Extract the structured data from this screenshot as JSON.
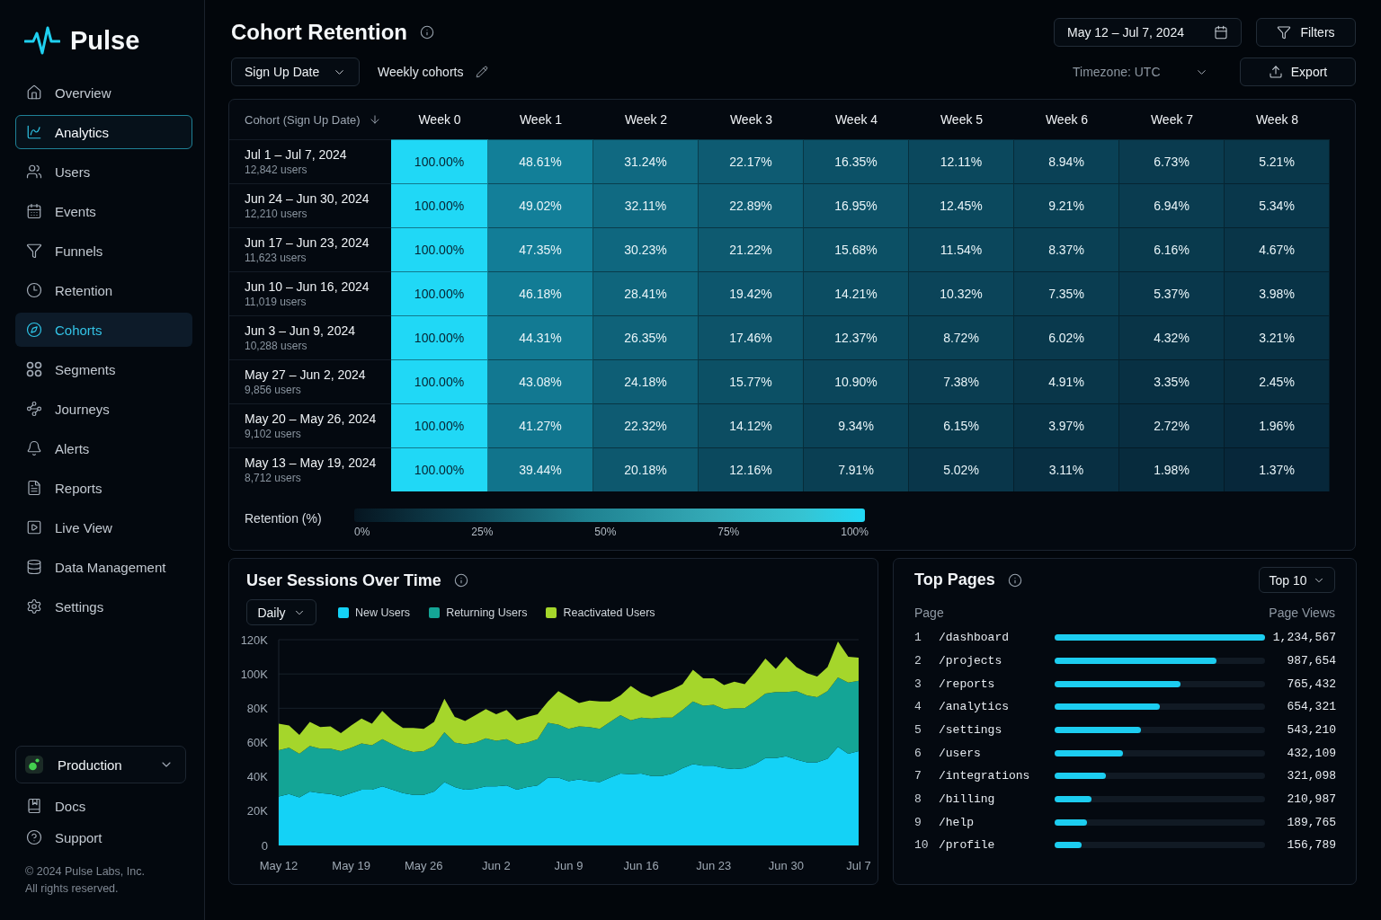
{
  "sidebar": {
    "brand": "Pulse",
    "nav": [
      {
        "label": "Overview",
        "selected": false,
        "focused": false
      },
      {
        "label": "Analytics",
        "selected": false,
        "focused": true
      },
      {
        "label": "Users",
        "selected": false,
        "focused": false
      },
      {
        "label": "Events",
        "selected": false,
        "focused": false
      },
      {
        "label": "Funnels",
        "selected": false,
        "focused": false
      },
      {
        "label": "Retention",
        "selected": false,
        "focused": false
      },
      {
        "label": "Cohorts",
        "selected": true,
        "focused": false
      },
      {
        "label": "Segments",
        "selected": false,
        "focused": false
      },
      {
        "label": "Journeys",
        "selected": false,
        "focused": false
      },
      {
        "label": "Alerts",
        "selected": false,
        "focused": false
      },
      {
        "label": "Reports",
        "selected": false,
        "focused": false
      },
      {
        "label": "Live View",
        "selected": false,
        "focused": false
      },
      {
        "label": "Data Management",
        "selected": false,
        "focused": false
      },
      {
        "label": "Settings",
        "selected": false,
        "focused": false
      }
    ],
    "environment": "Production",
    "links": [
      "Docs",
      "Support"
    ],
    "footer": [
      "© 2024 Pulse Labs, Inc.",
      "All rights reserved."
    ]
  },
  "header": {
    "title": "Cohort Retention",
    "date_range": "May 12 – Jul 7, 2024",
    "filters": "Filters",
    "cohort_by": "Sign Up Date",
    "cohort_type": "Weekly cohorts",
    "timezone": "Timezone: UTC",
    "export": "Export"
  },
  "retention_table": {
    "cohort_column": "Cohort (Sign Up Date)",
    "columns": [
      "Week 0",
      "Week 1",
      "Week 2",
      "Week 3",
      "Week 4",
      "Week 5",
      "Week 6",
      "Week 7",
      "Week 8"
    ],
    "rows": [
      {
        "cohort": "Jul 1 – Jul 7, 2024",
        "users": "12,842 users",
        "cells": [
          "100.00%",
          "48.61%",
          "31.24%",
          "22.17%",
          "16.35%",
          "12.11%",
          "8.94%",
          "6.73%",
          "5.21%"
        ]
      },
      {
        "cohort": "Jun 24 – Jun 30, 2024",
        "users": "12,210 users",
        "cells": [
          "100.00%",
          "49.02%",
          "32.11%",
          "22.89%",
          "16.95%",
          "12.45%",
          "9.21%",
          "6.94%",
          "5.34%"
        ]
      },
      {
        "cohort": "Jun 17 – Jun 23, 2024",
        "users": "11,623 users",
        "cells": [
          "100.00%",
          "47.35%",
          "30.23%",
          "21.22%",
          "15.68%",
          "11.54%",
          "8.37%",
          "6.16%",
          "4.67%"
        ]
      },
      {
        "cohort": "Jun 10 – Jun 16, 2024",
        "users": "11,019 users",
        "cells": [
          "100.00%",
          "46.18%",
          "28.41%",
          "19.42%",
          "14.21%",
          "10.32%",
          "7.35%",
          "5.37%",
          "3.98%"
        ]
      },
      {
        "cohort": "Jun 3 – Jun 9, 2024",
        "users": "10,288 users",
        "cells": [
          "100.00%",
          "44.31%",
          "26.35%",
          "17.46%",
          "12.37%",
          "8.72%",
          "6.02%",
          "4.32%",
          "3.21%"
        ]
      },
      {
        "cohort": "May 27 – Jun 2, 2024",
        "users": "9,856 users",
        "cells": [
          "100.00%",
          "43.08%",
          "24.18%",
          "15.77%",
          "10.90%",
          "7.38%",
          "4.91%",
          "3.35%",
          "2.45%"
        ]
      },
      {
        "cohort": "May 20 – May 26, 2024",
        "users": "9,102 users",
        "cells": [
          "100.00%",
          "41.27%",
          "22.32%",
          "14.12%",
          "9.34%",
          "6.15%",
          "3.97%",
          "2.72%",
          "1.96%"
        ]
      },
      {
        "cohort": "May 13 – May 19, 2024",
        "users": "8,712 users",
        "cells": [
          "100.00%",
          "39.44%",
          "20.18%",
          "12.16%",
          "7.91%",
          "5.02%",
          "3.11%",
          "1.98%",
          "1.37%"
        ]
      }
    ],
    "scale": {
      "label": "Retention (%)",
      "ticks": [
        "0%",
        "25%",
        "50%",
        "75%",
        "100%"
      ]
    }
  },
  "sessions": {
    "title": "User Sessions Over Time",
    "interval": "Daily",
    "chart_data": {
      "type": "area",
      "stacked": true,
      "grid": true,
      "categories": [
        "May 12",
        null,
        null,
        null,
        null,
        null,
        null,
        "May 19",
        null,
        null,
        null,
        null,
        null,
        null,
        "May 26",
        null,
        null,
        null,
        null,
        null,
        null,
        "Jun 2",
        null,
        null,
        null,
        null,
        null,
        null,
        "Jun 9",
        null,
        null,
        null,
        null,
        null,
        null,
        "Jun 16",
        null,
        null,
        null,
        null,
        null,
        null,
        "Jun 23",
        null,
        null,
        null,
        null,
        null,
        null,
        "Jun 30",
        null,
        null,
        null,
        null,
        null,
        null,
        "Jul 7"
      ],
      "ylim": [
        0,
        120
      ],
      "yticks": [
        {
          "value": 0,
          "label": "0"
        },
        {
          "value": 20,
          "label": "20K"
        },
        {
          "value": 40,
          "label": "40K"
        },
        {
          "value": 60,
          "label": "60K"
        },
        {
          "value": 80,
          "label": "80K"
        },
        {
          "value": 100,
          "label": "100K"
        },
        {
          "value": 120,
          "label": "120K"
        }
      ],
      "series": [
        {
          "name": "New Users",
          "color": "#14d2f6",
          "values": [
            28.5,
            30,
            28,
            31.5,
            30.5,
            30,
            28.5,
            30.5,
            32.5,
            32.5,
            34.5,
            32.5,
            30.5,
            29.5,
            29.5,
            31.5,
            37,
            34,
            32.5,
            33,
            34.5,
            34.5,
            35,
            32.5,
            34,
            35,
            39.5,
            39.5,
            37.5,
            38.5,
            37.5,
            37,
            39.5,
            42,
            41.5,
            42,
            40.5,
            40.5,
            42,
            45,
            47.5,
            46.5,
            46.5,
            45,
            44.5,
            45,
            47.5,
            51,
            51,
            52,
            50,
            48.5,
            48.5,
            50.5,
            57.5,
            53.5,
            55
          ]
        },
        {
          "name": "Returning Users",
          "color": "#14a596",
          "values": [
            27,
            27,
            25.5,
            26.5,
            26,
            26.5,
            26.5,
            26.5,
            27,
            26,
            27.5,
            26.5,
            25.5,
            25,
            25.5,
            26.5,
            29,
            26,
            26.5,
            27,
            28,
            26.5,
            27,
            26.5,
            26,
            27,
            32,
            31,
            30.5,
            31,
            31.5,
            31,
            32.5,
            34,
            31.5,
            32.5,
            33.5,
            34,
            32.5,
            34,
            36.5,
            35,
            35.5,
            34.5,
            35.5,
            35,
            36.5,
            37.5,
            38.5,
            37.5,
            40,
            39,
            38,
            39.5,
            40.5,
            41.5,
            41
          ]
        },
        {
          "name": "Reactivated Users",
          "color": "#a5d62b",
          "values": [
            15.5,
            13,
            11,
            14,
            12.5,
            13,
            10.5,
            13,
            14.5,
            12.5,
            16.5,
            13.5,
            12.5,
            14,
            13,
            14,
            19.5,
            15,
            13.5,
            16,
            17,
            15.5,
            17,
            14,
            15,
            14.5,
            12.5,
            19.5,
            18.5,
            13.5,
            15.5,
            16,
            12,
            11.5,
            20,
            14.5,
            12.5,
            14.5,
            16.5,
            15,
            18.5,
            16,
            15.5,
            14,
            15.5,
            14,
            17,
            20.5,
            13.5,
            20.5,
            14,
            13,
            12,
            14,
            21,
            15,
            13.5
          ]
        }
      ]
    }
  },
  "top_pages": {
    "title": "Top Pages",
    "limit": "Top 10",
    "columns": [
      "Page",
      "Page Views"
    ],
    "rows": [
      {
        "rank": "1",
        "path": "/dashboard",
        "level": 1.0,
        "views": "1,234,567"
      },
      {
        "rank": "2",
        "path": "/projects",
        "level": 0.77,
        "views": "987,654"
      },
      {
        "rank": "3",
        "path": "/reports",
        "level": 0.6,
        "views": "765,432"
      },
      {
        "rank": "4",
        "path": "/analytics",
        "level": 0.5,
        "views": "654,321"
      },
      {
        "rank": "5",
        "path": "/settings",
        "level": 0.41,
        "views": "543,210"
      },
      {
        "rank": "6",
        "path": "/users",
        "level": 0.325,
        "views": "432,109"
      },
      {
        "rank": "7",
        "path": "/integrations",
        "level": 0.245,
        "views": "321,098"
      },
      {
        "rank": "8",
        "path": "/billing",
        "level": 0.175,
        "views": "210,987"
      },
      {
        "rank": "9",
        "path": "/help",
        "level": 0.155,
        "views": "189,765"
      },
      {
        "rank": "10",
        "path": "/profile",
        "level": 0.13,
        "views": "156,789"
      }
    ]
  }
}
